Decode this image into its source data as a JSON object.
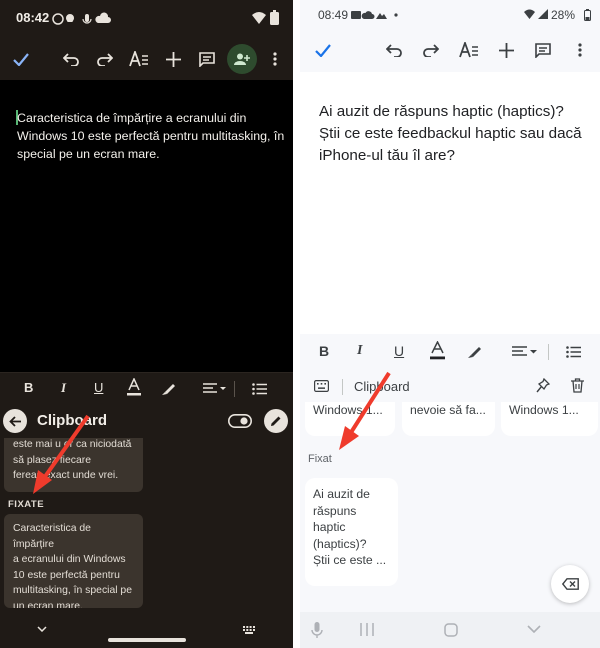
{
  "left": {
    "status": {
      "time": "08:42"
    },
    "document": {
      "text": "Caracteristica de împărțire a ecranului din Windows 10 este perfectă pentru multitasking, în special pe un ecran mare."
    },
    "clipboard": {
      "title": "Clipboard",
      "recent_lines": [
        "este mai u  or ca niciodată",
        "să plasez  fiecare",
        "fereas    exact unde vrei."
      ],
      "pinned_label": "FIXATE",
      "pinned_lines": [
        "Caracteristica de împărțire",
        "a ecranului din Windows",
        "10 este perfectă pentru",
        "multitasking, în special pe",
        "un ecran mare."
      ]
    },
    "icons": [
      "check-icon",
      "undo-icon",
      "redo-icon",
      "text-format-icon",
      "add-icon",
      "comment-icon",
      "add-person-icon",
      "more-icon"
    ],
    "colors": {
      "background": "#1f1a16",
      "card": "#3b342d",
      "accent": "#2e4b2e"
    }
  },
  "right": {
    "status": {
      "time": "08:49",
      "battery": "28%"
    },
    "document": {
      "text": "Ai auzit de răspuns haptic (haptics)? Știi ce este feedbackul haptic sau dacă iPhone-ul tău îl are?"
    },
    "clipboard": {
      "title": "Clipboard",
      "recent": [
        "Windows 1...",
        "nevoie să fa...",
        "Windows 1..."
      ],
      "pinned_label": "Fixat",
      "pinned_lines": [
        "Ai auzit de",
        "răspuns",
        "haptic",
        "(haptics)?",
        "Știi ce este ..."
      ]
    },
    "colors": {
      "background": "#f7f8fb",
      "card": "#ffffff",
      "text": "#202124"
    }
  },
  "annotation": {
    "arrow_color": "#ef3b2c"
  }
}
